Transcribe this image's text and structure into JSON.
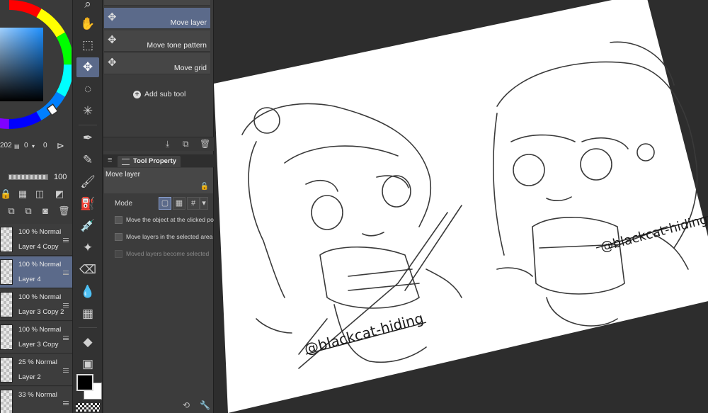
{
  "color": {
    "readout": [
      "202",
      "0",
      "0"
    ]
  },
  "layer_controls": {
    "opacity": "100"
  },
  "layers": [
    {
      "blend": "100 % Normal",
      "name": "Layer 4 Copy",
      "selected": false
    },
    {
      "blend": "100 % Normal",
      "name": "Layer 4",
      "selected": true
    },
    {
      "blend": "100 % Normal",
      "name": "Layer 3 Copy 2",
      "selected": false
    },
    {
      "blend": "100 % Normal",
      "name": "Layer 3 Copy",
      "selected": false
    },
    {
      "blend": "25 % Normal",
      "name": "Layer 2",
      "selected": false
    },
    {
      "blend": "33 % Normal",
      "name": "",
      "selected": false
    }
  ],
  "subtools": {
    "items": [
      {
        "label": "Move layer",
        "selected": true
      },
      {
        "label": "Move tone pattern",
        "selected": false
      },
      {
        "label": "Move grid",
        "selected": false
      }
    ],
    "add_label": "Add sub tool"
  },
  "tool_property": {
    "tab_label": "Tool Property",
    "title": "Move layer",
    "mode_label": "Mode",
    "options": [
      {
        "label": "Move the object at the clicked position",
        "enabled": true
      },
      {
        "label": "Move layers in the selected area",
        "enabled": true
      },
      {
        "label": "Moved layers become selected",
        "enabled": false
      }
    ]
  },
  "canvas": {
    "watermark_left": "@blackcat-hiding",
    "watermark_right": "@blackcat-hiding"
  },
  "colors": {
    "accent": "#5b6a8a",
    "panel": "#3c3c3c",
    "foreground": "#000000",
    "background": "#ffffff"
  }
}
